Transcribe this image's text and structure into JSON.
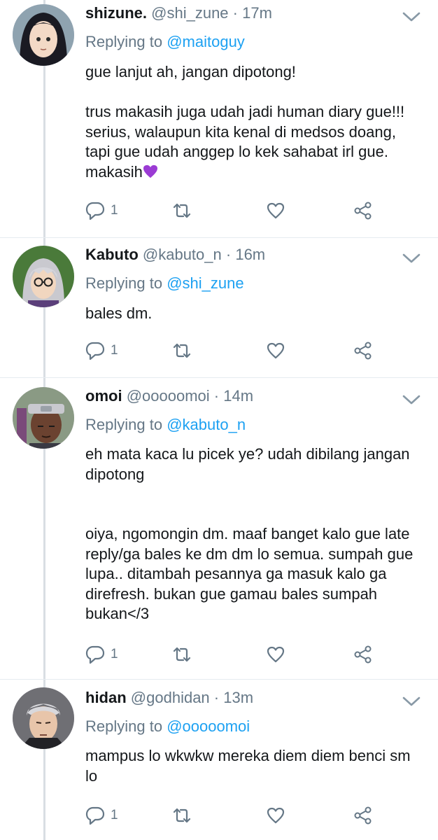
{
  "colors": {
    "link": "#1da1f2",
    "secondary_text": "#657786",
    "primary_text": "#14171a",
    "thread_line": "#d9dee3",
    "purple_heart": "#9b3bd4"
  },
  "tweets": [
    {
      "name": "shizune.",
      "handle": "@shi_zune",
      "separator": "·",
      "time": "17m",
      "replying_prefix": "Replying to",
      "replying_to": "@maitoguy",
      "text": "gue lanjut ah, jangan dipotong!\n\ntrus makasih juga udah jadi human diary gue!!! serius, walaupun kita kenal di medsos doang, tapi gue udah anggep lo kek sahabat irl gue. makasih",
      "emoji": "purple-heart",
      "reply_count": "1",
      "avatar_icon": "avatar-shizune"
    },
    {
      "name": "Kabuto",
      "handle": "@kabuto_n",
      "separator": "·",
      "time": "16m",
      "replying_prefix": "Replying to",
      "replying_to": "@shi_zune",
      "text": "bales dm.",
      "reply_count": "1",
      "avatar_icon": "avatar-kabuto"
    },
    {
      "name": "omoi",
      "handle": "@ooooomoi",
      "separator": "·",
      "time": "14m",
      "replying_prefix": "Replying to",
      "replying_to": "@kabuto_n",
      "text": "eh mata kaca lu picek ye? udah dibilang jangan dipotong\n\n\noiya, ngomongin dm. maaf banget kalo gue late reply/ga bales ke dm dm lo semua. sumpah gue lupa.. ditambah pesannya ga masuk kalo ga direfresh. bukan gue gamau bales sumpah bukan</3",
      "reply_count": "1",
      "avatar_icon": "avatar-omoi"
    },
    {
      "name": "hidan",
      "handle": "@godhidan",
      "separator": "·",
      "time": "13m",
      "replying_prefix": "Replying to",
      "replying_to": "@ooooomoi",
      "text": "mampus lo wkwkw mereka diem diem benci sm lo",
      "reply_count": "1",
      "avatar_icon": "avatar-hidan"
    }
  ]
}
